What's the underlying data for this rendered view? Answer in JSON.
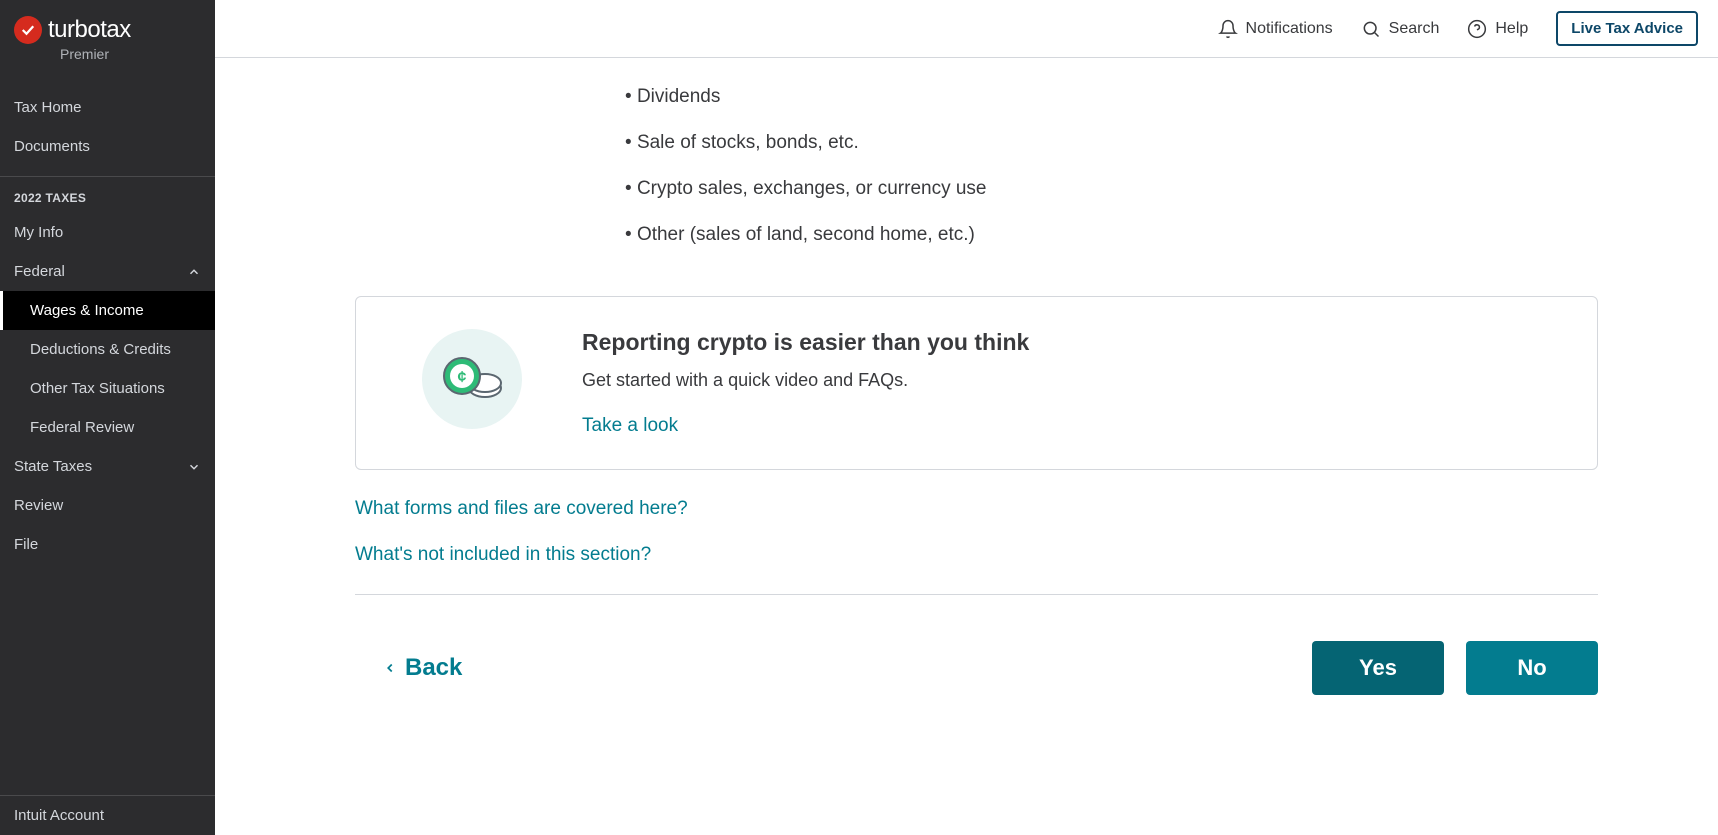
{
  "brand": {
    "name": "turbotax",
    "tier": "Premier"
  },
  "sidebar": {
    "top": [
      {
        "label": "Tax Home"
      },
      {
        "label": "Documents"
      }
    ],
    "section_label": "2022 TAXES",
    "items": [
      {
        "label": "My Info"
      },
      {
        "label": "Federal",
        "expanded": true,
        "children": [
          {
            "label": "Wages & Income",
            "active": true
          },
          {
            "label": "Deductions & Credits"
          },
          {
            "label": "Other Tax Situations"
          },
          {
            "label": "Federal Review"
          }
        ]
      },
      {
        "label": "State Taxes",
        "expanded": false
      },
      {
        "label": "Review"
      },
      {
        "label": "File"
      }
    ],
    "bottom": {
      "label": "Intuit Account"
    }
  },
  "topbar": {
    "notifications": "Notifications",
    "search": "Search",
    "help": "Help",
    "live": "Live Tax Advice"
  },
  "content": {
    "bullets": [
      "Dividends",
      "Sale of stocks, bonds, etc.",
      "Crypto sales, exchanges, or currency use",
      "Other (sales of land, second home, etc.)"
    ],
    "card": {
      "title": "Reporting crypto is easier than you think",
      "desc": "Get started with a quick video and FAQs.",
      "link": "Take a look"
    },
    "help_links": [
      "What forms and files are covered here?",
      "What's not included in this section?"
    ],
    "actions": {
      "back": "Back",
      "yes": "Yes",
      "no": "No"
    }
  }
}
